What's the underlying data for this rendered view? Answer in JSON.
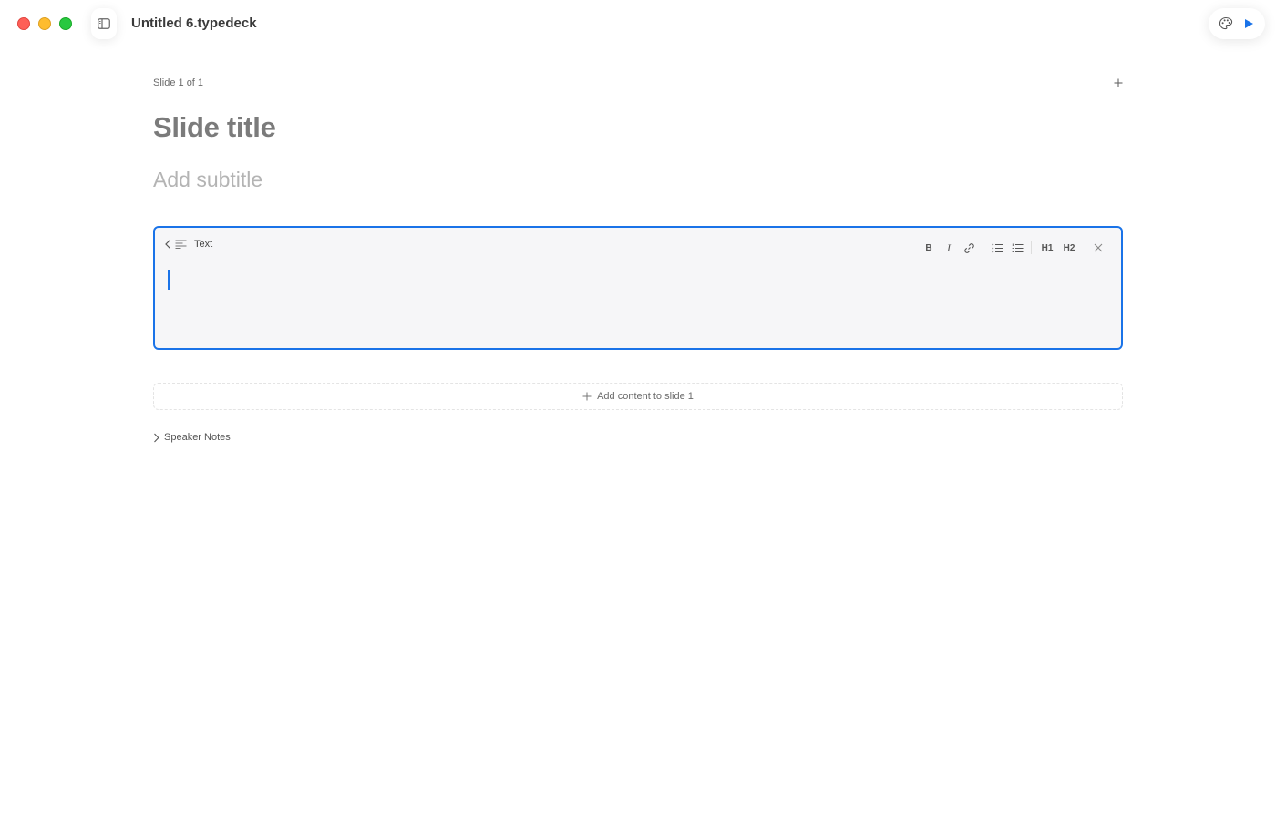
{
  "window": {
    "title": "Untitled 6.typedeck"
  },
  "slide": {
    "counter": "Slide 1 of 1",
    "title": "Slide title",
    "subtitle_placeholder": "Add subtitle"
  },
  "text_block": {
    "label": "Text",
    "toolbar": {
      "bold": "B",
      "italic": "I",
      "h1": "H1",
      "h2": "H2"
    }
  },
  "add_content": {
    "label": "Add content to slide 1"
  },
  "speaker_notes": {
    "label": "Speaker Notes"
  },
  "colors": {
    "accent": "#1a73e8",
    "play": "#1a73e8"
  }
}
